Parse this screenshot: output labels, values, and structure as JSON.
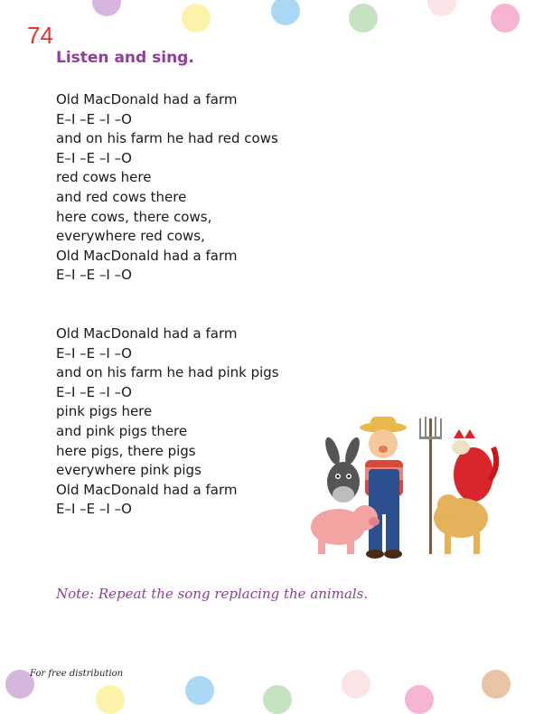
{
  "page_number": "74",
  "heading": "Listen and sing.",
  "verses": [
    {
      "lines": [
        "Old MacDonald had a farm",
        "E–I –E –I –O",
        "and on his farm he had red cows",
        "E–I –E –I –O",
        "red cows here",
        "and red cows there",
        "here cows, there cows,",
        "everywhere red cows,",
        "Old MacDonald had a farm",
        "E–I –E –I –O"
      ]
    },
    {
      "lines": [
        "Old MacDonald had a farm",
        "E–I –E –I –O",
        "and on his farm he had pink pigs",
        "E–I –E –I –O",
        "pink pigs here",
        "and pink pigs there",
        "here pigs, there pigs",
        "everywhere pink pigs",
        "Old MacDonald had a farm",
        "E–I –E –I –O"
      ]
    }
  ],
  "note": "Note: Repeat the song replacing the animals.",
  "footer": "For free distribution",
  "colors": {
    "page_number": "#e8322f",
    "heading": "#8e3e9b",
    "note": "#8e3e9b",
    "dot_purple": "#d5b7dd",
    "dot_yellow": "#fbf3a8",
    "dot_blue": "#a9d9f5",
    "dot_green": "#c5e3c1",
    "dot_pink_light": "#fbe4e6",
    "dot_pink": "#f6b4d5",
    "dot_tan": "#e9c4a3"
  },
  "illustration": {
    "icon": "old-macdonald-farm-illustration",
    "subjects": [
      "farmer",
      "donkey",
      "pig",
      "rooster",
      "cow"
    ]
  }
}
